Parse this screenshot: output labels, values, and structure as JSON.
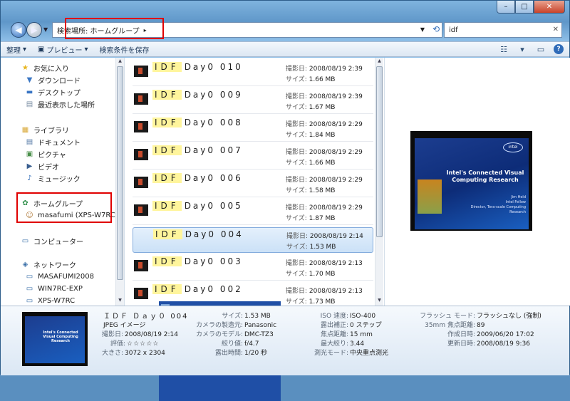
{
  "window": {
    "minimize": "–",
    "maximize": "□",
    "close": "✕"
  },
  "address": {
    "text": "検索場所: ホームグループ",
    "arrow": "▸"
  },
  "search": {
    "value": "idf",
    "clear": "✕"
  },
  "toolbar": {
    "organize": "整理",
    "preview": "プレビュー",
    "save_search": "検索条件を保存"
  },
  "nav": {
    "favorites": "お気に入り",
    "downloads": "ダウンロード",
    "desktop": "デスクトップ",
    "recent": "最近表示した場所",
    "libraries": "ライブラリ",
    "documents": "ドキュメント",
    "pictures": "ピクチャ",
    "videos": "ビデオ",
    "music": "ミュージック",
    "homegroup": "ホームグループ",
    "homegroup_user": "masafumi (XPS-W7RC)",
    "computer": "コンピューター",
    "network": "ネットワーク",
    "net1": "MASAFUMI2008",
    "net2": "WIN7RC-EXP",
    "net3": "XPS-W7RC"
  },
  "files": [
    {
      "hit": "IDF",
      "rest": "Day0 010",
      "date": "2008/08/19 2:39",
      "size": "1.66 MB"
    },
    {
      "hit": "IDF",
      "rest": "Day0 009",
      "date": "2008/08/19 2:39",
      "size": "1.67 MB"
    },
    {
      "hit": "IDF",
      "rest": "Day0 008",
      "date": "2008/08/19 2:29",
      "size": "1.84 MB"
    },
    {
      "hit": "IDF",
      "rest": "Day0 007",
      "date": "2008/08/19 2:29",
      "size": "1.66 MB"
    },
    {
      "hit": "IDF",
      "rest": "Day0 006",
      "date": "2008/08/19 2:29",
      "size": "1.58 MB"
    },
    {
      "hit": "IDF",
      "rest": "Day0 005",
      "date": "2008/08/19 2:29",
      "size": "1.87 MB"
    },
    {
      "hit": "IDF",
      "rest": "Day0 004",
      "date": "2008/08/19 2:14",
      "size": "1.53 MB"
    },
    {
      "hit": "IDF",
      "rest": "Day0 003",
      "date": "2008/08/19 2:13",
      "size": "1.70 MB"
    },
    {
      "hit": "IDF",
      "rest": "Day0 002",
      "date": "2008/08/19 2:13",
      "size": "1.73 MB"
    }
  ],
  "labels": {
    "date": "撮影日:",
    "size": "サイズ:"
  },
  "preview": {
    "logo": "intel",
    "title": "Intel's Connected Visual Computing Research",
    "presenter": "Jim Held",
    "role": "Intel Fellow",
    "dept": "Director, Tera-scale Computing Research"
  },
  "details": {
    "name": "ＩＤＦ Ｄａｙ０ 004",
    "type": "JPEG イメージ",
    "date_k": "撮影日:",
    "date_v": "2008/08/19 2:14",
    "rating_k": "評価:",
    "rating_v": "☆☆☆☆☆",
    "dims_k": "大きさ:",
    "dims_v": "3072 x 2304",
    "size_k": "サイズ:",
    "size_v": "1.53 MB",
    "maker_k": "カメラの製造元:",
    "maker_v": "Panasonic",
    "model_k": "カメラのモデル:",
    "model_v": "DMC-TZ3",
    "fstop_k": "絞り値:",
    "fstop_v": "f/4.7",
    "exposure_k": "露出時間:",
    "exposure_v": "1/20 秒",
    "iso_k": "ISO 速度:",
    "iso_v": "ISO-400",
    "bias_k": "露出補正:",
    "bias_v": "0 ステップ",
    "focal_k": "焦点距離:",
    "focal_v": "15 mm",
    "aperture_k": "最大絞り:",
    "aperture_v": "3.44",
    "metering_k": "測光モード:",
    "metering_v": "中央重点測光",
    "flash_k": "フラッシュ モード:",
    "flash_v": "フラッシュなし (強制)",
    "focal35_k": "35mm 焦点距離:",
    "focal35_v": "89",
    "created_k": "作成日時:",
    "created_v": "2009/06/20 17:02",
    "modified_k": "更新日時:",
    "modified_v": "2008/08/19 9:36"
  }
}
